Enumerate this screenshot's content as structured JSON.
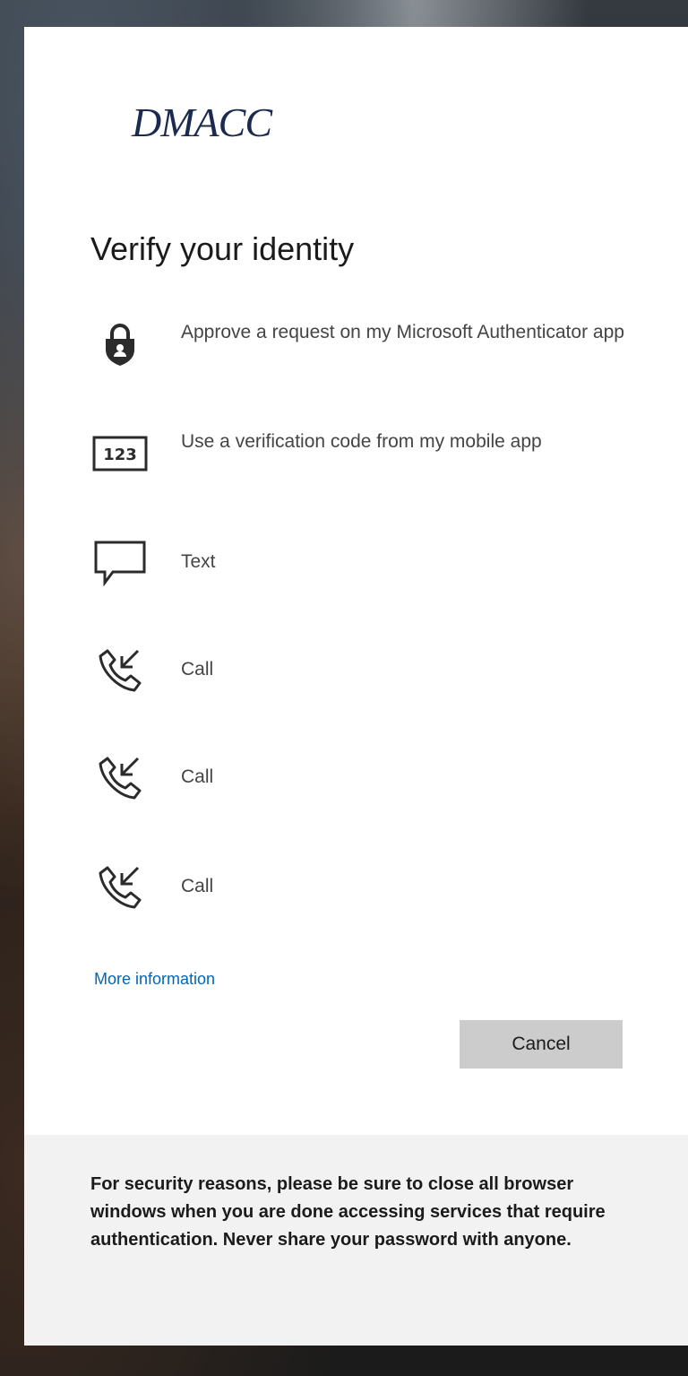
{
  "brand": {
    "logo_text": "DMACC"
  },
  "page": {
    "title": "Verify your identity"
  },
  "options": [
    {
      "icon": "authenticator-lock-icon",
      "label": "Approve a request on my Microsoft Authenticator app"
    },
    {
      "icon": "verification-code-123-icon",
      "label": "Use a verification code from my mobile app",
      "icon_text": "123"
    },
    {
      "icon": "text-message-icon",
      "label": "Text"
    },
    {
      "icon": "phone-call-icon",
      "label": "Call"
    },
    {
      "icon": "phone-call-icon",
      "label": "Call"
    },
    {
      "icon": "phone-call-icon",
      "label": "Call"
    }
  ],
  "links": {
    "more_information": "More information"
  },
  "actions": {
    "cancel_label": "Cancel"
  },
  "footer": {
    "notice": "For security reasons, please be sure to close all browser windows when you are done accessing services that require authentication. Never share your password with anyone."
  },
  "colors": {
    "link": "#0067b8",
    "logo": "#1b2a4e",
    "button_bg": "#cccccc",
    "footer_bg": "#f2f2f2"
  }
}
